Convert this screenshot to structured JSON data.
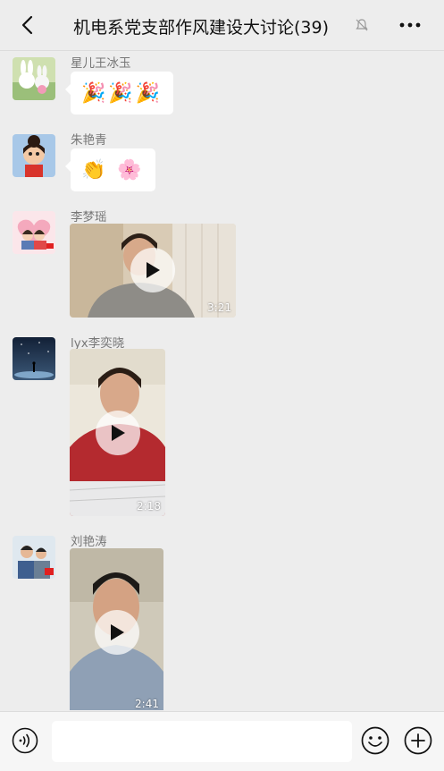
{
  "header": {
    "title": "机电系党支部作风建设大讨论(39)",
    "back_icon": "chevron-left-icon",
    "muted_icon": "bell-muted-icon",
    "more_icon": "more-dots-icon"
  },
  "messages": [
    {
      "sender": "星儿王冰玉",
      "content": "🎉🎉🎉"
    },
    {
      "sender": "朱艳青",
      "content": "👏 🌸"
    },
    {
      "sender": "李梦瑶",
      "duration": "3:21"
    },
    {
      "sender": "lyx李奕晓",
      "duration": "2:18"
    },
    {
      "sender": "刘艳涛",
      "duration": "2:41"
    }
  ],
  "input_bar": {
    "voice_icon": "voice-icon",
    "emoji_icon": "emoji-icon",
    "plus_icon": "plus-icon",
    "text_value": ""
  }
}
